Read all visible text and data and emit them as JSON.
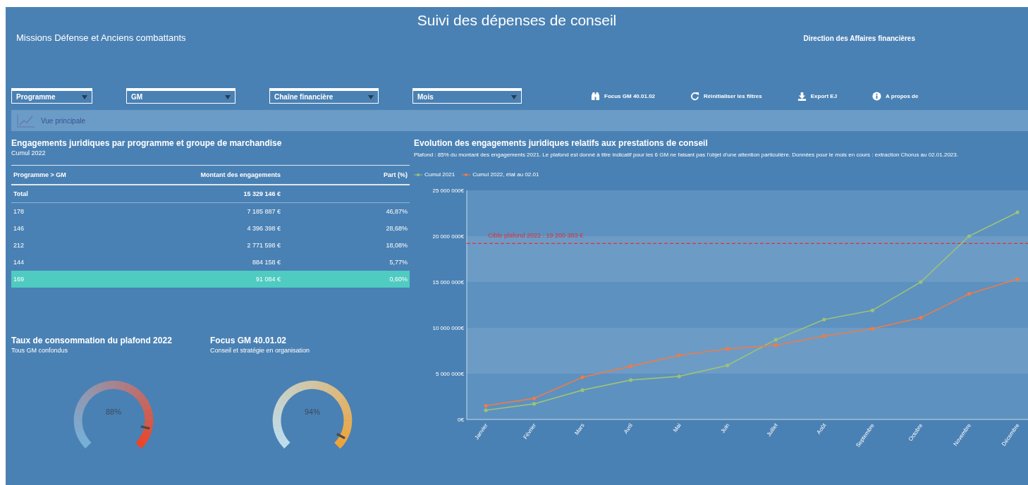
{
  "header": {
    "title": "Suivi des dépenses de conseil",
    "subtitle": "Missions Défense et Anciens combattants",
    "organization": "Direction des Affaires financières"
  },
  "filters": [
    {
      "label": "Programme"
    },
    {
      "label": "GM"
    },
    {
      "label": "Chaîne financière"
    },
    {
      "label": "Mois"
    }
  ],
  "actions": [
    {
      "kind": "binoculars",
      "label": "Focus GM 40.01.02"
    },
    {
      "kind": "refresh",
      "label": "Réinitialiser les filtres"
    },
    {
      "kind": "download",
      "label": "Export EJ"
    },
    {
      "kind": "info",
      "label": "A propos de"
    }
  ],
  "nav_tab": {
    "label": "Vue principale"
  },
  "table_panel": {
    "title": "Engagements juridiques par programme et groupe de marchandise",
    "subtitle": "Cumul 2022",
    "columns": [
      "Programme > GM",
      "Montant des engagements",
      "Part (%)"
    ],
    "rows": [
      {
        "kind": "total",
        "cells": [
          "Total",
          "15 329 146 €",
          ""
        ],
        "selected": false
      },
      {
        "kind": "data",
        "cells": [
          "178",
          "7 185 887 €",
          "46,87%"
        ],
        "selected": false
      },
      {
        "kind": "data",
        "cells": [
          "146",
          "4 396 398 €",
          "28,68%"
        ],
        "selected": false
      },
      {
        "kind": "data",
        "cells": [
          "212",
          "2 771 598 €",
          "18,08%"
        ],
        "selected": false
      },
      {
        "kind": "data",
        "cells": [
          "144",
          "884 158 €",
          "5,77%"
        ],
        "selected": false
      },
      {
        "kind": "data",
        "cells": [
          "169",
          "91 084 €",
          "0,60%"
        ],
        "selected": true
      }
    ]
  },
  "gauges": [
    {
      "title": "Taux de consommation du plafond 2022",
      "subtitle": "Tous GM confondus",
      "reading": "88%"
    },
    {
      "title": "Focus GM 40.01.02",
      "subtitle": "Conseil et stratégie en organisation",
      "reading": "94%"
    }
  ],
  "chart_panel": {
    "title": "Evolution des engagements juridiques relatifs aux prestations de conseil",
    "note": "Plafond : 85% du montant des engagements 2021. Le plafond est donné à titre indicatif pour les 6 GM ne faisant pas l'objet d'une attention particulière. Données pour le mois en cours : extraction Chorus au 02.01.2023.",
    "chart_data": {
      "type": "line",
      "categories": [
        "Janvier",
        "Février",
        "Mars",
        "Avril",
        "Mai",
        "Juin",
        "Juillet",
        "Août",
        "Septembre",
        "Octobre",
        "Novembre",
        "Décembre"
      ],
      "series": [
        {
          "name": "Cumul 2021",
          "color": "#9cc17a",
          "values": [
            1000000,
            1700000,
            3200000,
            4300000,
            4700000,
            5900000,
            8700000,
            10900000,
            11900000,
            15000000,
            20000000,
            22600000
          ]
        },
        {
          "name": "Cumul 2022, état au 02.01",
          "color": "#f07a48",
          "values": [
            1500000,
            2300000,
            4600000,
            5800000,
            7000000,
            7700000,
            8100000,
            9100000,
            9900000,
            11100000,
            13700000,
            15300000
          ]
        }
      ],
      "ylim": [
        0,
        25000000
      ],
      "yticks": [
        {
          "value": 0,
          "label": "0€"
        },
        {
          "value": 5000000,
          "label": "5 000 000€"
        },
        {
          "value": 10000000,
          "label": "10 000 000€"
        },
        {
          "value": 15000000,
          "label": "15 000 000€"
        },
        {
          "value": 20000000,
          "label": "20 000 000€"
        },
        {
          "value": 25000000,
          "label": "25 000 000€"
        }
      ],
      "ref_lines": [
        {
          "axis": "y",
          "value": 19200303,
          "label": "Cible plafond 2022 : 19 200 303 €",
          "color": "#e0303a"
        }
      ]
    }
  }
}
